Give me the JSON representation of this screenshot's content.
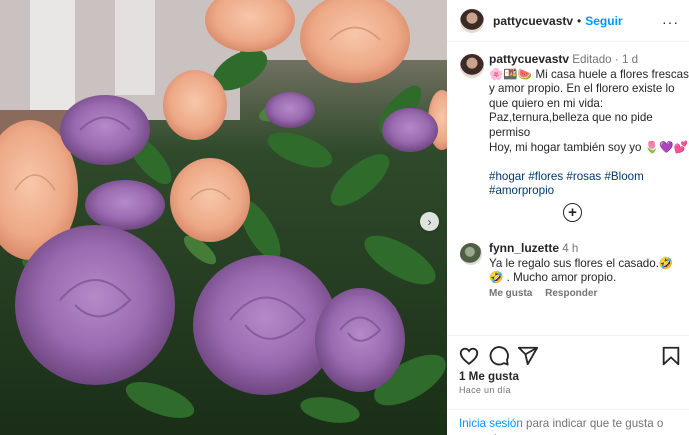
{
  "post": {
    "username": "pattycuevastv",
    "follow_label": "Seguir",
    "more_label": "···",
    "caption": {
      "username": "pattycuevastv",
      "edited": "Editado",
      "time": "1 d",
      "line1": "🌸🍱🍉 Mi casa huele a flores frescas y amor propio. En el florero existe lo que quiero en mi vida:",
      "line2": "Paz,ternura,belleza que no pide permiso",
      "line3": "Hoy, mi hogar también soy yo 🌷💜💕",
      "hashtags": [
        "#hogar",
        "#flores",
        "#rosas",
        "#Bloom",
        "#amorpropio"
      ]
    },
    "load_more_label": "+",
    "comment": {
      "username": "fynn_luzette",
      "time": "4 h",
      "text": "Ya le regalo sus flores el casado.🤣🤣 . Mucho amor propio.",
      "like_action": "Me gusta",
      "reply_action": "Responder"
    },
    "likes": "1 Me gusta",
    "ago": "Hace un día",
    "login_link": "Inicia sesión",
    "login_rest": " para indicar que te gusta o comentar."
  },
  "icons": {
    "next": "chevron-right-icon",
    "like": "heart-icon",
    "comment": "comment-icon",
    "share": "share-icon",
    "save": "bookmark-icon",
    "add": "plus-circle-icon"
  },
  "colors": {
    "link_blue": "#0095f6",
    "hashtag": "#00376b",
    "muted": "#737373",
    "text": "#262626"
  }
}
